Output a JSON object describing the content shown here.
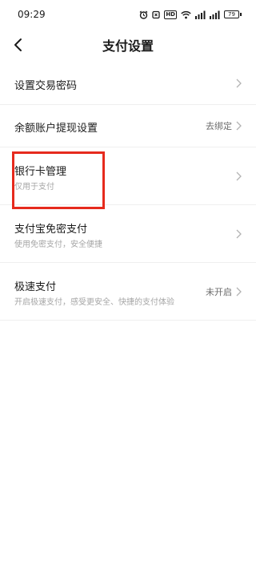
{
  "status_bar": {
    "time": "09:29",
    "battery": "79",
    "network_badge": "HD"
  },
  "header": {
    "title": "支付设置"
  },
  "settings": [
    {
      "title": "设置交易密码"
    },
    {
      "title": "余额账户提现设置",
      "value": "去绑定"
    },
    {
      "title": "银行卡管理",
      "subtitle": "仅用于支付"
    },
    {
      "title": "支付宝免密支付",
      "subtitle": "使用免密支付，安全便捷"
    },
    {
      "title": "极速支付",
      "subtitle": "开启极速支付，感受更安全、快捷的支付体验",
      "value": "未开启"
    }
  ],
  "colors": {
    "highlight": "#e62a1d",
    "subtitle": "#a6a6a6",
    "divider": "#efefef"
  }
}
